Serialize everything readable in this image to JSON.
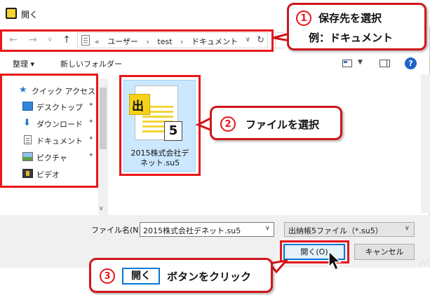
{
  "window": {
    "title": "開く"
  },
  "nav": {
    "back": "←",
    "forward": "→",
    "recent": "∨",
    "up": "↑",
    "breadcrumbs": [
      "«",
      "ユーザー",
      "›",
      "test",
      "›",
      "ドキュメント"
    ],
    "dropdown": "∨",
    "refresh": "↻"
  },
  "toolbar": {
    "organize": "整理 ▾",
    "new_folder": "新しいフォルダー",
    "help": "?"
  },
  "sidebar": {
    "items": [
      {
        "label": "クイック アクセス",
        "icon": "star-icon",
        "pinned": false
      },
      {
        "label": "デスクトップ",
        "icon": "desktop-icon",
        "pinned": true
      },
      {
        "label": "ダウンロード",
        "icon": "download-icon",
        "pinned": true
      },
      {
        "label": "ドキュメント",
        "icon": "document-icon",
        "pinned": true
      },
      {
        "label": "ピクチャ",
        "icon": "pictures-icon",
        "pinned": true
      },
      {
        "label": "ビデオ",
        "icon": "video-icon",
        "pinned": false
      }
    ],
    "pin_glyph": "📌"
  },
  "file": {
    "badge": "出",
    "number": "5",
    "name_line1": "2015株式会社デ",
    "name_line2": "ネット.su5"
  },
  "bottom": {
    "filename_label": "ファイル名(N):",
    "filename_value": "2015株式会社デネット.su5",
    "filetype_value": "出納帳5ファイル（*.su5）",
    "open_button": "開く(O)",
    "cancel_button": "キャンセル"
  },
  "callouts": {
    "step1": {
      "num": "1",
      "line1": "保存先を選択",
      "line2": "例：ドキュメント"
    },
    "step2": {
      "num": "2",
      "text": "ファイルを選択"
    },
    "step3": {
      "num": "3",
      "button": "開く",
      "text": "ボタンをクリック"
    }
  },
  "colors": {
    "highlight": "#e8161b",
    "accent": "#0078d7",
    "selection": "#cce8ff",
    "help": "#1e64c8"
  }
}
